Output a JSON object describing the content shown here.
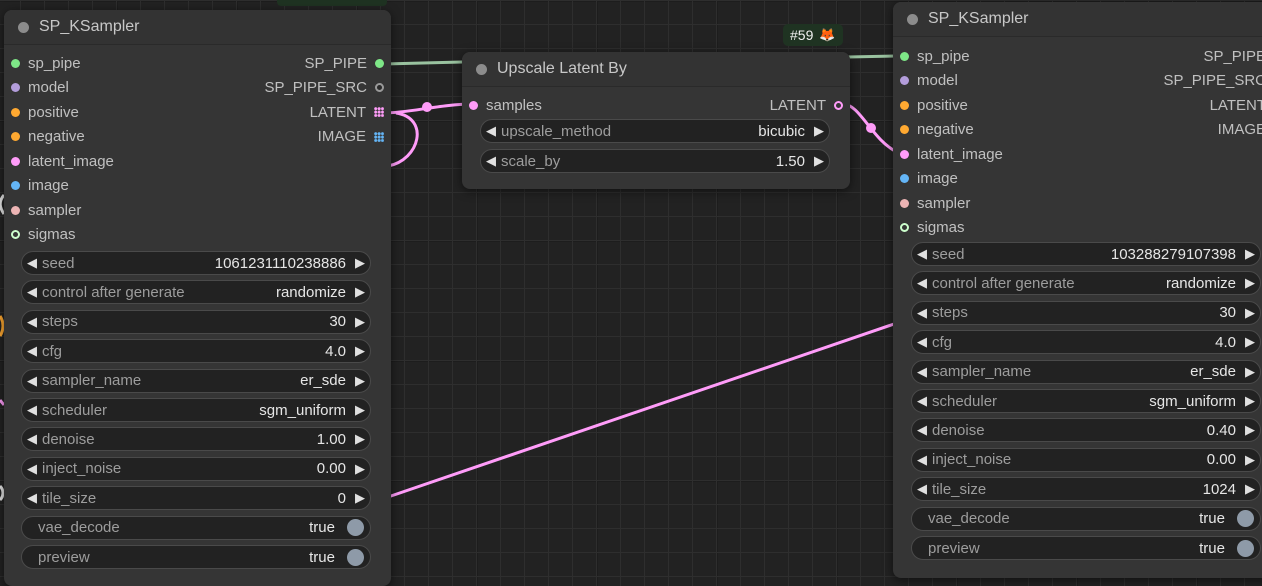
{
  "colors": {
    "canvas_bg": "#222222",
    "node_bg": "#353535",
    "latent_link": "#ff9cf9",
    "pipe_link": "#9ac3a0"
  },
  "badge": {
    "label": "#59",
    "icon": "fox-emoji",
    "icon_glyph": "🦊"
  },
  "left_node": {
    "title": "SP_KSampler",
    "inputs": [
      {
        "label": "sp_pipe",
        "color": "#7ee787"
      },
      {
        "label": "model",
        "color": "#b39ddb"
      },
      {
        "label": "positive",
        "color": "#ffa931"
      },
      {
        "label": "negative",
        "color": "#ffa931"
      },
      {
        "label": "latent_image",
        "color": "#ff9cf9"
      },
      {
        "label": "image",
        "color": "#64b5f6"
      },
      {
        "label": "sampler",
        "color": "#ecb4b4"
      },
      {
        "label": "sigmas",
        "color": "#cdffcd"
      }
    ],
    "outputs": [
      {
        "label": "SP_PIPE",
        "color": "#7ee787",
        "icon": "dot"
      },
      {
        "label": "SP_PIPE_SRC",
        "color": "#7a7a7a",
        "icon": "dot"
      },
      {
        "label": "LATENT",
        "color": "#ff9cf9",
        "icon": "grid-icon"
      },
      {
        "label": "IMAGE",
        "color": "#64b5f6",
        "icon": "grid-icon"
      }
    ],
    "widgets": [
      {
        "label": "seed",
        "value": "1061231110238886",
        "type": "number"
      },
      {
        "label": "control after generate",
        "value": "randomize",
        "type": "combo"
      },
      {
        "label": "steps",
        "value": "30",
        "type": "number"
      },
      {
        "label": "cfg",
        "value": "4.0",
        "type": "number"
      },
      {
        "label": "sampler_name",
        "value": "er_sde",
        "type": "combo"
      },
      {
        "label": "scheduler",
        "value": "sgm_uniform",
        "type": "combo"
      },
      {
        "label": "denoise",
        "value": "1.00",
        "type": "number"
      },
      {
        "label": "inject_noise",
        "value": "0.00",
        "type": "number"
      },
      {
        "label": "tile_size",
        "value": "0",
        "type": "number"
      },
      {
        "label": "vae_decode",
        "value": "true",
        "type": "toggle"
      },
      {
        "label": "preview",
        "value": "true",
        "type": "toggle"
      }
    ]
  },
  "middle_node": {
    "title": "Upscale Latent By",
    "inputs": [
      {
        "label": "samples",
        "color": "#ff9cf9"
      }
    ],
    "outputs": [
      {
        "label": "LATENT",
        "color": "#ff9cf9",
        "icon": "dot"
      }
    ],
    "widgets": [
      {
        "label": "upscale_method",
        "value": "bicubic",
        "type": "combo"
      },
      {
        "label": "scale_by",
        "value": "1.50",
        "type": "number"
      }
    ]
  },
  "right_node": {
    "title": "SP_KSampler",
    "inputs": [
      {
        "label": "sp_pipe",
        "color": "#7ee787"
      },
      {
        "label": "model",
        "color": "#b39ddb"
      },
      {
        "label": "positive",
        "color": "#ffa931"
      },
      {
        "label": "negative",
        "color": "#ffa931"
      },
      {
        "label": "latent_image",
        "color": "#ff9cf9"
      },
      {
        "label": "image",
        "color": "#64b5f6"
      },
      {
        "label": "sampler",
        "color": "#ecb4b4"
      },
      {
        "label": "sigmas",
        "color": "#cdffcd"
      }
    ],
    "outputs": [
      {
        "label": "SP_PIPE"
      },
      {
        "label": "SP_PIPE_SRC"
      },
      {
        "label": "LATENT"
      },
      {
        "label": "IMAGE"
      }
    ],
    "widgets": [
      {
        "label": "seed",
        "value": "103288279107398",
        "type": "number"
      },
      {
        "label": "control after generate",
        "value": "randomize",
        "type": "combo"
      },
      {
        "label": "steps",
        "value": "30",
        "type": "number"
      },
      {
        "label": "cfg",
        "value": "4.0",
        "type": "number"
      },
      {
        "label": "sampler_name",
        "value": "er_sde",
        "type": "combo"
      },
      {
        "label": "scheduler",
        "value": "sgm_uniform",
        "type": "combo"
      },
      {
        "label": "denoise",
        "value": "0.40",
        "type": "number"
      },
      {
        "label": "inject_noise",
        "value": "0.00",
        "type": "number"
      },
      {
        "label": "tile_size",
        "value": "1024",
        "type": "number"
      },
      {
        "label": "vae_decode",
        "value": "true",
        "type": "toggle"
      },
      {
        "label": "preview",
        "value": "true",
        "type": "toggle"
      }
    ]
  }
}
